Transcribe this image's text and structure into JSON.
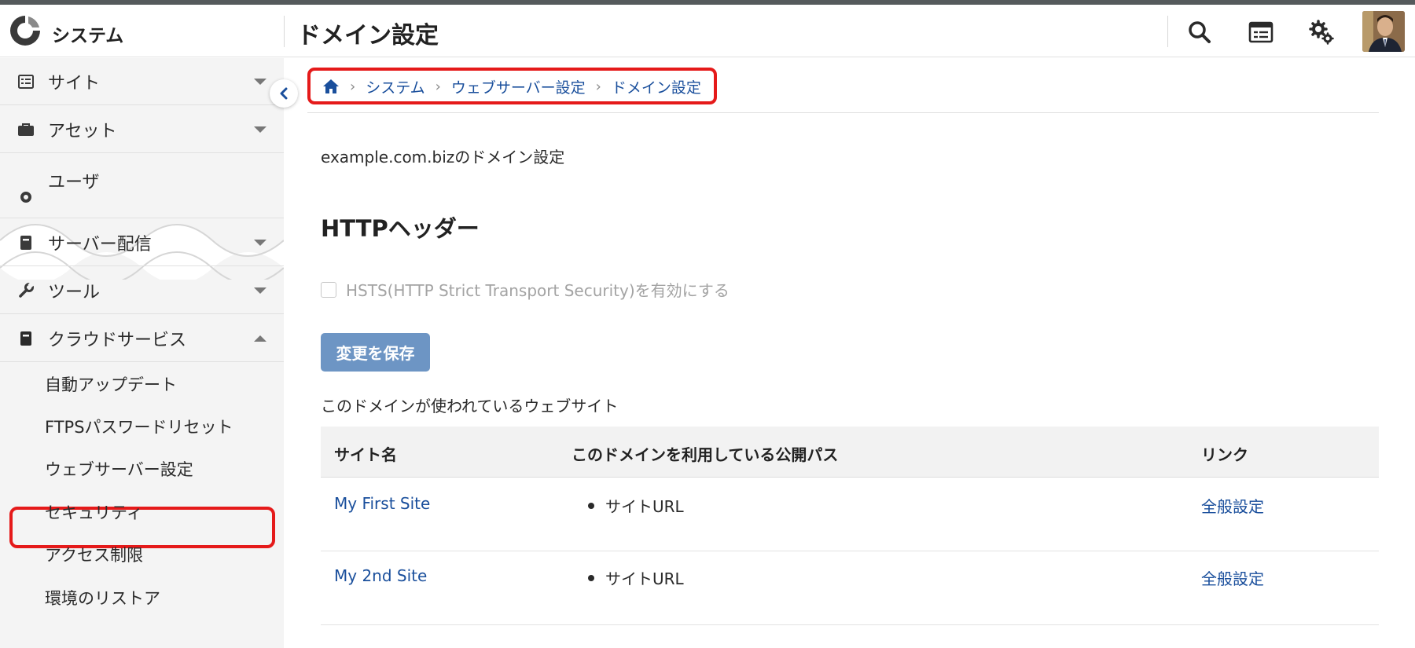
{
  "app": {
    "brand": "システム"
  },
  "header": {
    "title": "ドメイン設定"
  },
  "sidebar": {
    "items": [
      {
        "label": "サイト",
        "expanded": false
      },
      {
        "label": "アセット",
        "expanded": false
      },
      {
        "label": "ユーザ",
        "expanded": false
      },
      {
        "label": "サーバー配信",
        "expanded": false
      },
      {
        "label": "ツール",
        "expanded": false
      },
      {
        "label": "クラウドサービス",
        "expanded": true
      }
    ],
    "subitems": [
      {
        "label": "自動アップデート"
      },
      {
        "label": "FTPSパスワードリセット"
      },
      {
        "label": "ウェブサーバー設定",
        "highlighted": true
      },
      {
        "label": "セキュリティ"
      },
      {
        "label": "アクセス制限"
      },
      {
        "label": "環境のリストア"
      }
    ]
  },
  "breadcrumb": [
    "システム",
    "ウェブサーバー設定",
    "ドメイン設定"
  ],
  "main": {
    "domain_desc": "example.com.bizのドメイン設定",
    "section_title": "HTTPヘッダー",
    "hsts_label": "HSTS(HTTP Strict Transport Security)を有効にする",
    "hsts_checked": false,
    "save_label": "変更を保存",
    "used_label": "このドメインが使われているウェブサイト"
  },
  "table": {
    "headers": [
      "サイト名",
      "このドメインを利用している公開パス",
      "リンク"
    ],
    "rows": [
      {
        "site": "My First Site",
        "path": "サイトURL",
        "link": "全般設定"
      },
      {
        "site": "My 2nd Site",
        "path": "サイトURL",
        "link": "全般設定"
      }
    ]
  },
  "colors": {
    "link": "#1a4f9c",
    "highlight": "#e51a1a",
    "button": "#6d95c4"
  }
}
